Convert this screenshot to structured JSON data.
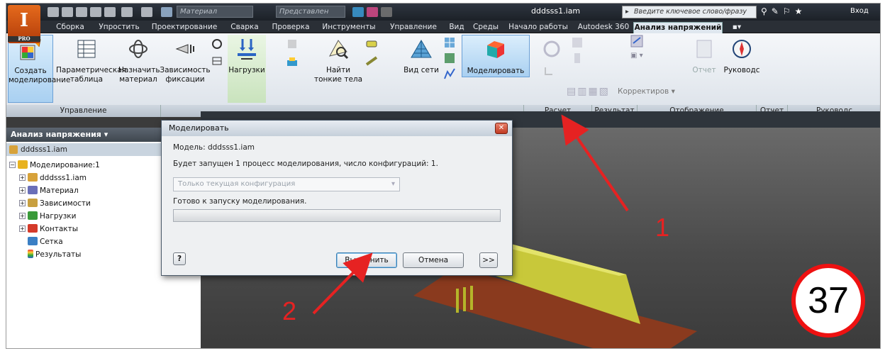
{
  "titlebar": {
    "app_logo": "I",
    "app_logo_sub": "PRO",
    "material_field": "Материал",
    "appearance_field": "Представлен",
    "document_title": "dddsss1.iam",
    "search_placeholder": "Введите ключевое слово/фразу",
    "signin_label": "Вход"
  },
  "tabs": [
    "Сборка",
    "Упростить",
    "Проектирование",
    "Сварка",
    "Проверка",
    "Инструменты",
    "Управление",
    "Вид",
    "Среды",
    "Начало работы",
    "Autodesk 360",
    "Анализ напряжений"
  ],
  "active_tab": "Анализ напряжений",
  "ribbon": {
    "create_sim": "Создать моделирование",
    "param_table": "Параметрическая таблица",
    "assign_mat": "Назначить материал",
    "constraints": "Зависимость фиксации",
    "loads": "Нагрузки",
    "find_thin": "Найти тонкие тела",
    "mesh_view": "Вид сети",
    "simulate": "Моделировать",
    "adjust": "Корректиров",
    "report": "Отчет",
    "guide": "Руководс",
    "panels": {
      "manage": "Управление",
      "solve": "Расчет",
      "result": "Результат",
      "display": "Отображение",
      "report": "Отчет",
      "guide": "Руководс"
    }
  },
  "browser": {
    "header": "Анализ напряжения",
    "root": "dddsss1.iam",
    "items": [
      "Моделирование:1",
      "dddsss1.iam",
      "Материал",
      "Зависимости",
      "Нагрузки",
      "Контакты",
      "Сетка",
      "Результаты"
    ]
  },
  "dialog": {
    "title": "Моделировать",
    "model_line": "Модель: dddsss1.iam",
    "info_line": "Будет запущен 1 процесс моделирования, число конфигураций: 1.",
    "combo_value": "Только текущая конфигурация",
    "ready_line": "Готово к запуску моделирования.",
    "help": "?",
    "run": "Выполнить",
    "cancel": "Отмена",
    "more": ">>"
  },
  "annotations": {
    "step1": "1",
    "step2": "2",
    "page_number": "37"
  },
  "colors": {
    "accent_red": "#e62222",
    "active_tab_bg": "#dfe7ef",
    "beam_yellow": "#c8c83a",
    "plate_brown": "#8a3a1e"
  }
}
